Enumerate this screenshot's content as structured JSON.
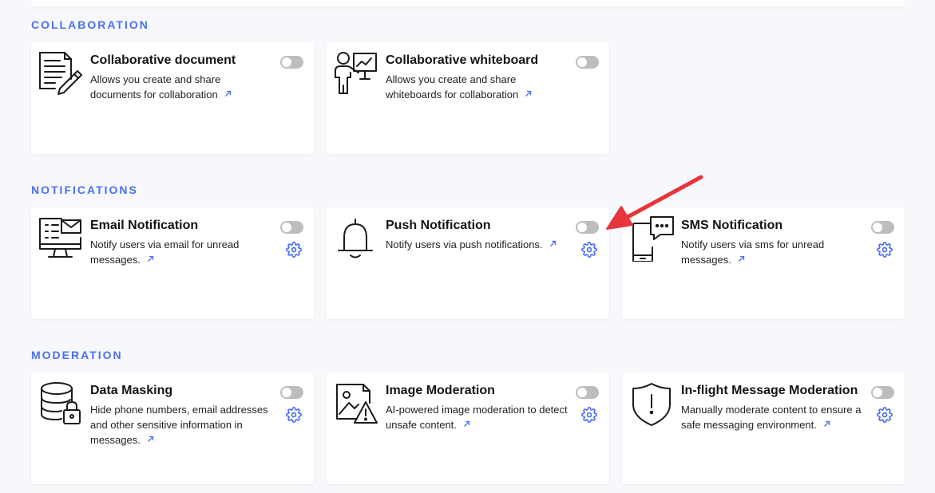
{
  "sections": {
    "collaboration": "COLLABORATION",
    "notifications": "NOTIFICATIONS",
    "moderation": "MODERATION"
  },
  "cards": {
    "collab_doc": {
      "title": "Collaborative document",
      "desc": "Allows you create and share documents for collaboration",
      "enabled": false,
      "icon": "document-pencil-icon"
    },
    "collab_whiteboard": {
      "title": "Collaborative whiteboard",
      "desc": "Allows you create and share whiteboards for collaboration",
      "enabled": false,
      "icon": "whiteboard-presenter-icon"
    },
    "email_notification": {
      "title": "Email Notification",
      "desc": "Notify users via email for unread messages.",
      "enabled": false,
      "icon": "monitor-email-icon"
    },
    "push_notification": {
      "title": "Push Notification",
      "desc": "Notify users via push notifications.",
      "enabled": false,
      "icon": "bell-icon"
    },
    "sms_notification": {
      "title": "SMS Notification",
      "desc": "Notify users via sms for unread messages.",
      "enabled": false,
      "icon": "phone-chat-icon"
    },
    "data_masking": {
      "title": "Data Masking",
      "desc": "Hide phone numbers, email addresses and other sensitive information in messages.",
      "enabled": false,
      "icon": "database-lock-icon"
    },
    "image_moderation": {
      "title": "Image Moderation",
      "desc": "AI-powered image moderation to detect unsafe content.",
      "enabled": false,
      "icon": "image-warning-icon"
    },
    "inflight_moderation": {
      "title": "In-flight Message Moderation",
      "desc": "Manually moderate content to ensure a safe messaging environment.",
      "enabled": false,
      "icon": "shield-alert-icon"
    }
  },
  "colors": {
    "accent": "#4b6ff0",
    "toggle_off": "#bdbdbd",
    "annotation_arrow": "#e8343c",
    "background": "#f7f8fb"
  }
}
